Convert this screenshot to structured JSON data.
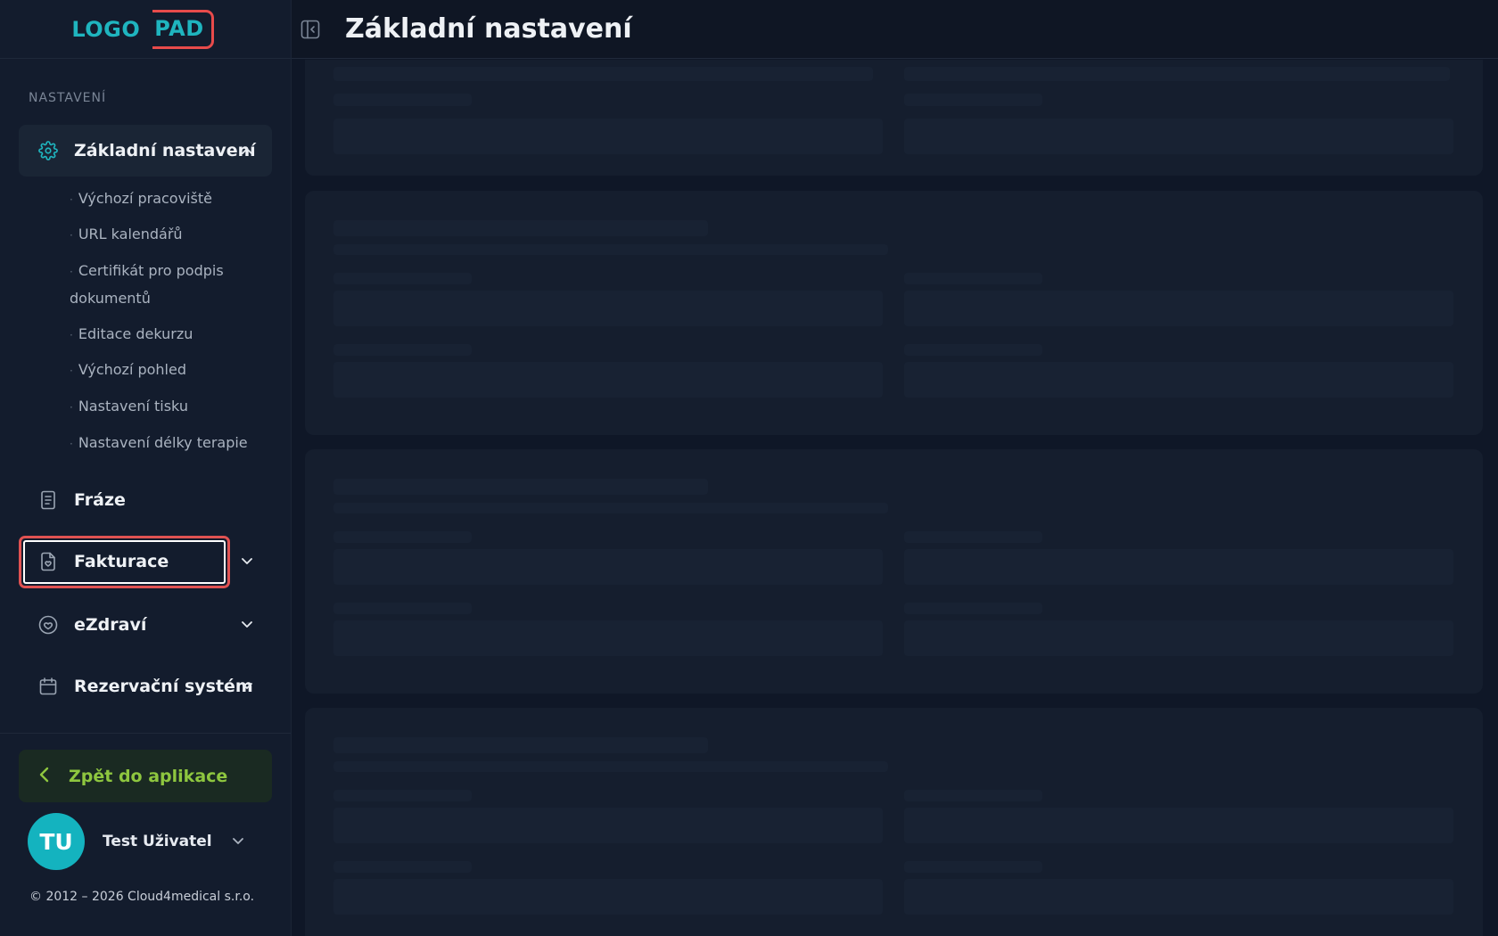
{
  "logo": {
    "part1": "LOGO",
    "part2": "PAD"
  },
  "sidebar": {
    "section_label": "NASTAVENÍ",
    "items": [
      {
        "label": "Základní nastavení",
        "icon": "gear-icon",
        "expanded": true
      },
      {
        "label": "Fráze",
        "icon": "document-icon"
      },
      {
        "label": "Fakturace",
        "icon": "invoice-icon"
      },
      {
        "label": "eZdraví",
        "icon": "heart-icon"
      },
      {
        "label": "Rezervační systém",
        "icon": "calendar-icon"
      }
    ],
    "sub_items": [
      "Výchozí pracoviště",
      "URL kalendářů",
      "Certifikát pro podpis dokumentů",
      "Editace dekurzu",
      "Výchozí pohled",
      "Nastavení tisku",
      "Nastavení délky terapie"
    ],
    "back_label": "Zpět do aplikace",
    "user": {
      "initials": "TU",
      "name": "Test Uživatel"
    },
    "footer": "© 2012 – 2026 Cloud4medical s.r.o."
  },
  "header": {
    "title": "Základní nastavení"
  },
  "colors": {
    "accent": "#14b3bf",
    "back_green": "#8ec63f",
    "highlight_red": "#e05252",
    "background": "#0f1727"
  }
}
